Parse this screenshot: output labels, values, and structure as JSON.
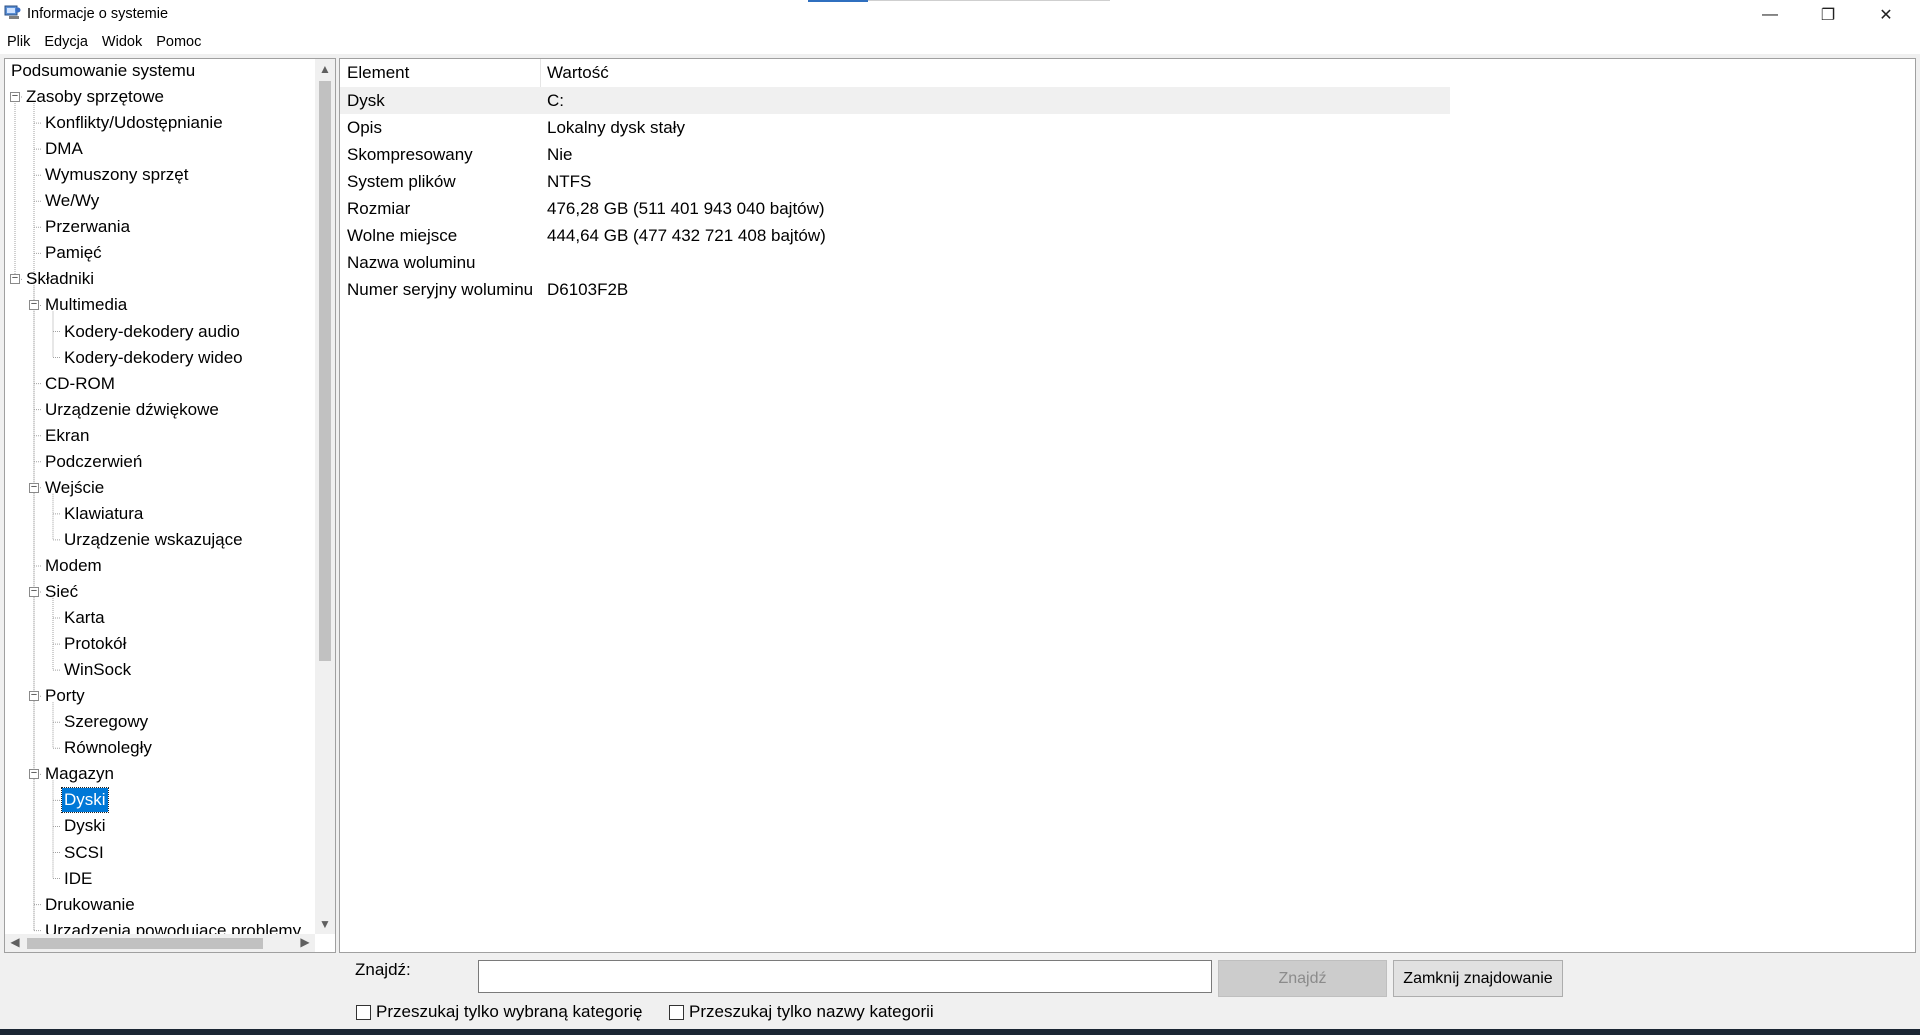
{
  "window": {
    "title": "Informacje o systemie",
    "controls": {
      "minimize": "—",
      "maximize": "❐",
      "close": "✕"
    }
  },
  "menu": [
    "Plik",
    "Edycja",
    "Widok",
    "Pomoc"
  ],
  "tree": [
    {
      "label": "Podsumowanie systemu",
      "level": 0,
      "expander": false
    },
    {
      "label": "Zasoby sprzętowe",
      "level": 0,
      "expander": true
    },
    {
      "label": "Konflikty/Udostępnianie",
      "level": 1,
      "expander": false
    },
    {
      "label": "DMA",
      "level": 1,
      "expander": false
    },
    {
      "label": "Wymuszony sprzęt",
      "level": 1,
      "expander": false
    },
    {
      "label": "We/Wy",
      "level": 1,
      "expander": false
    },
    {
      "label": "Przerwania",
      "level": 1,
      "expander": false
    },
    {
      "label": "Pamięć",
      "level": 1,
      "expander": false
    },
    {
      "label": "Składniki",
      "level": 0,
      "expander": true
    },
    {
      "label": "Multimedia",
      "level": 1,
      "expander": true
    },
    {
      "label": "Kodery-dekodery audio",
      "level": 2,
      "expander": false
    },
    {
      "label": "Kodery-dekodery wideo",
      "level": 2,
      "expander": false
    },
    {
      "label": "CD-ROM",
      "level": 1,
      "expander": false
    },
    {
      "label": "Urządzenie dźwiękowe",
      "level": 1,
      "expander": false
    },
    {
      "label": "Ekran",
      "level": 1,
      "expander": false
    },
    {
      "label": "Podczerwień",
      "level": 1,
      "expander": false
    },
    {
      "label": "Wejście",
      "level": 1,
      "expander": true
    },
    {
      "label": "Klawiatura",
      "level": 2,
      "expander": false
    },
    {
      "label": "Urządzenie wskazujące",
      "level": 2,
      "expander": false
    },
    {
      "label": "Modem",
      "level": 1,
      "expander": false
    },
    {
      "label": "Sieć",
      "level": 1,
      "expander": true
    },
    {
      "label": "Karta",
      "level": 2,
      "expander": false
    },
    {
      "label": "Protokół",
      "level": 2,
      "expander": false
    },
    {
      "label": "WinSock",
      "level": 2,
      "expander": false
    },
    {
      "label": "Porty",
      "level": 1,
      "expander": true
    },
    {
      "label": "Szeregowy",
      "level": 2,
      "expander": false
    },
    {
      "label": "Równoległy",
      "level": 2,
      "expander": false
    },
    {
      "label": "Magazyn",
      "level": 1,
      "expander": true
    },
    {
      "label": "Dyski",
      "level": 2,
      "expander": false,
      "selected": true
    },
    {
      "label": "Dyski",
      "level": 2,
      "expander": false
    },
    {
      "label": "SCSI",
      "level": 2,
      "expander": false
    },
    {
      "label": "IDE",
      "level": 2,
      "expander": false
    },
    {
      "label": "Drukowanie",
      "level": 1,
      "expander": false
    },
    {
      "label": "Urządzenia powodujące problemy",
      "level": 1,
      "expander": false
    }
  ],
  "details": {
    "columns": [
      "Element",
      "Wartość"
    ],
    "rows": [
      [
        "Dysk",
        "C:"
      ],
      [
        "Opis",
        "Lokalny dysk stały"
      ],
      [
        "Skompresowany",
        "Nie"
      ],
      [
        "System plików",
        "NTFS"
      ],
      [
        "Rozmiar",
        "476,28 GB (511 401 943 040 bajtów)"
      ],
      [
        "Wolne miejsce",
        "444,64 GB (477 432 721 408 bajtów)"
      ],
      [
        "Nazwa woluminu",
        ""
      ],
      [
        "Numer seryjny woluminu",
        "D6103F2B"
      ]
    ]
  },
  "find": {
    "label": "Znajdź:",
    "input_value": "",
    "find_button": "Znajdź",
    "close_button": "Zamknij znajdowanie",
    "check_selected_category": "Przeszukaj tylko wybraną kategorię",
    "check_category_names": "Przeszukaj tylko nazwy kategorii"
  },
  "colors": {
    "selection": "#0078d7",
    "titlebar": "#ffffff",
    "panel_bg": "#f0f0f0"
  }
}
